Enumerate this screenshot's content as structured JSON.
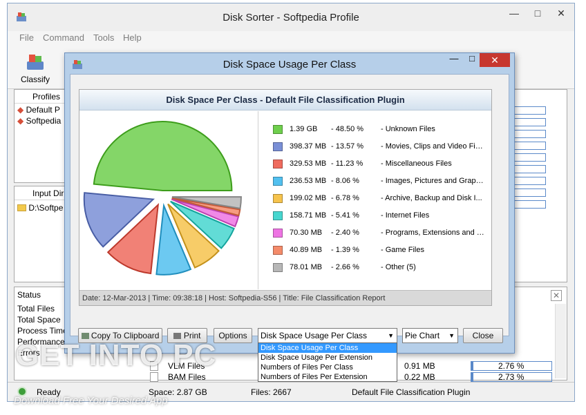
{
  "main": {
    "title": "Disk Sorter - Softpedia Profile",
    "menu": [
      "File",
      "Command",
      "Tools",
      "Help"
    ],
    "toolbar_classify": "Classify",
    "profiles_header": "Profiles",
    "profiles": [
      "Default P",
      "Softpedia"
    ],
    "input_header": "Input Dir",
    "input_dirs": [
      "D:\\Softpe"
    ],
    "status_header": "Status",
    "status_rows": [
      "Total Files",
      "Total Space",
      "Process Time",
      "Performance",
      "Errors"
    ],
    "files": [
      {
        "name": "VLM Files",
        "size": "0.91 MB",
        "pct": "2.76 %",
        "fill": 0.0276
      },
      {
        "name": "BAM Files",
        "size": "0.22 MB",
        "pct": "2.73 %",
        "fill": 0.0273
      }
    ],
    "status_bar": {
      "state": "Ready",
      "space": "Space: 2.87 GB",
      "files": "Files: 2667",
      "plugin": "Default File Classification Plugin"
    }
  },
  "dialog": {
    "title": "Disk Space Usage Per Class",
    "report_title": "Disk Space Per Class - Default File Classification Plugin",
    "footer": "Date: 12-Mar-2013 | Time: 09:38:18 | Host: Softpedia-S56 | Title: File Classification Report",
    "buttons": {
      "copy": "Copy To Clipboard",
      "print": "Print",
      "options": "Options",
      "close": "Close"
    },
    "view_select": "Disk Space Usage Per Class",
    "chart_select": "Pie Chart",
    "dropdown_options": [
      "Disk Space Usage Per Class",
      "Disk Space Usage Per Extension",
      "Numbers of Files Per Class",
      "Numbers of Files Per Extension"
    ],
    "dropdown_selected": "Disk Space Usage Per Class"
  },
  "chart_data": {
    "type": "pie",
    "title": "Disk Space Per Class - Default File Classification Plugin",
    "slices": [
      {
        "size": "1.39 GB",
        "percent": 48.5,
        "label": "- 48.50 %",
        "name": "- Unknown Files",
        "color": "#6fcf4d"
      },
      {
        "size": "398.37 MB",
        "percent": 13.57,
        "label": "- 13.57 %",
        "name": "- Movies, Clips and Video Files",
        "color": "#7a8fd6"
      },
      {
        "size": "329.53 MB",
        "percent": 11.23,
        "label": "- 11.23 %",
        "name": "- Miscellaneous Files",
        "color": "#ef6b5e"
      },
      {
        "size": "236.53 MB",
        "percent": 8.06,
        "label": "- 8.06 %",
        "name": "- Images, Pictures and Graph...",
        "color": "#52c0ef"
      },
      {
        "size": "199.02 MB",
        "percent": 6.78,
        "label": "- 6.78 %",
        "name": "- Archive, Backup and Disk I...",
        "color": "#f6c34d"
      },
      {
        "size": "158.71 MB",
        "percent": 5.41,
        "label": "- 5.41 %",
        "name": "- Internet Files",
        "color": "#47d6cf"
      },
      {
        "size": "70.30 MB",
        "percent": 2.4,
        "label": "- 2.40 %",
        "name": "- Programs, Extensions and S...",
        "color": "#ee74e3"
      },
      {
        "size": "40.89 MB",
        "percent": 1.39,
        "label": "- 1.39 %",
        "name": "- Game Files",
        "color": "#f48b6a"
      },
      {
        "size": "78.01 MB",
        "percent": 2.66,
        "label": "- 2.66 %",
        "name": "- Other (5)",
        "color": "#b7b7b7"
      }
    ]
  },
  "watermark": {
    "big": "GET INTO PC",
    "small": "Download Free Your Desired App"
  }
}
